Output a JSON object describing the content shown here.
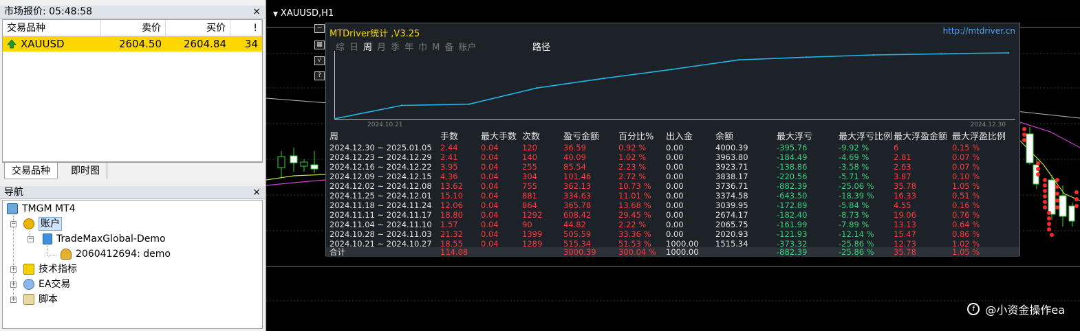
{
  "market_watch": {
    "title": "市场报价: 05:48:58",
    "close": "×",
    "headers": [
      "交易品种",
      "卖价",
      "买价",
      "!"
    ],
    "rows": [
      {
        "symbol": "XAUUSD",
        "bid": "2604.50",
        "ask": "2604.84",
        "spread": "34"
      }
    ],
    "tabs": [
      "交易品种",
      "即时图"
    ]
  },
  "navigator": {
    "title": "导航",
    "close": "×",
    "items": [
      {
        "label": "TMGM MT4"
      },
      {
        "label": "账户"
      },
      {
        "label": "TradeMaxGlobal-Demo"
      },
      {
        "label": "2060412694: demo"
      },
      {
        "label": "技术指标"
      },
      {
        "label": "EA交易"
      },
      {
        "label": "脚本"
      }
    ]
  },
  "chart": {
    "symbol": "XAUUSD,H1",
    "watermark": "@小资金操作ea"
  },
  "stats_panel": {
    "title": "MTDriver统计 ,V3.25",
    "url": "http://mtdriver.cn",
    "periods": [
      "综",
      "日",
      "周",
      "月",
      "季",
      "年",
      "巾",
      "M",
      "备",
      "账户"
    ],
    "active_period": "周",
    "route_label": "路径",
    "chart_start_label": "2024.10.21",
    "chart_end_label": "2024.12.30",
    "headers": [
      "周",
      "手数",
      "最大手数",
      "次数",
      "盈亏金额",
      "百分比%",
      "出入金",
      "余额",
      "最大浮亏",
      "最大浮亏比例",
      "最大浮盈金额",
      "最大浮盈比例"
    ],
    "rows": [
      [
        "2024.12.30 ~ 2025.01.05",
        "2.44",
        "0.04",
        "120",
        "36.59",
        "0.92 %",
        "0.00",
        "4000.39",
        "-395.76",
        "-9.92 %",
        "6",
        "0.15 %"
      ],
      [
        "2024.12.23 ~ 2024.12.29",
        "2.41",
        "0.04",
        "140",
        "40.09",
        "1.02 %",
        "0.00",
        "3963.80",
        "-184.49",
        "-4.69 %",
        "2.81",
        "0.07 %"
      ],
      [
        "2024.12.16 ~ 2024.12.22",
        "3.95",
        "0.04",
        "255",
        "85.54",
        "2.23 %",
        "0.00",
        "3923.71",
        "-138.86",
        "-3.58 %",
        "2.63",
        "0.07 %"
      ],
      [
        "2024.12.09 ~ 2024.12.15",
        "4.36",
        "0.04",
        "304",
        "101.46",
        "2.72 %",
        "0.00",
        "3838.17",
        "-220.56",
        "-5.71 %",
        "3.87",
        "0.10 %"
      ],
      [
        "2024.12.02 ~ 2024.12.08",
        "13.62",
        "0.04",
        "755",
        "362.13",
        "10.73 %",
        "0.00",
        "3736.71",
        "-882.39",
        "-25.06 %",
        "35.78",
        "1.05 %"
      ],
      [
        "2024.11.25 ~ 2024.12.01",
        "15.10",
        "0.04",
        "881",
        "334.63",
        "11.01 %",
        "0.00",
        "3374.58",
        "-643.50",
        "-18.39 %",
        "16.33",
        "0.51 %"
      ],
      [
        "2024.11.18 ~ 2024.11.24",
        "12.06",
        "0.04",
        "864",
        "365.78",
        "13.68 %",
        "0.00",
        "3039.95",
        "-172.89",
        "-5.84 %",
        "4.55",
        "0.16 %"
      ],
      [
        "2024.11.11 ~ 2024.11.17",
        "18.80",
        "0.04",
        "1292",
        "608.42",
        "29.45 %",
        "0.00",
        "2674.17",
        "-182.40",
        "-8.73 %",
        "19.06",
        "0.76 %"
      ],
      [
        "2024.11.04 ~ 2024.11.10",
        "1.57",
        "0.04",
        "90",
        "44.82",
        "2.22 %",
        "0.00",
        "2065.75",
        "-161.99",
        "-7.89 %",
        "13.13",
        "0.64 %"
      ],
      [
        "2024.10.28 ~ 2024.11.03",
        "21.32",
        "0.04",
        "1399",
        "505.59",
        "33.36 %",
        "0.00",
        "2020.93",
        "-121.93",
        "-12.14 %",
        "15.47",
        "0.86 %"
      ],
      [
        "2024.10.21 ~ 2024.10.27",
        "18.55",
        "0.04",
        "1289",
        "515.34",
        "51.53 %",
        "1000.00",
        "1515.34",
        "-373.32",
        "-25.86 %",
        "12.73",
        "1.02 %"
      ]
    ],
    "total": [
      "合计",
      "114.08",
      "",
      "",
      "3000.39",
      "300.04 %",
      "1000.00",
      "",
      "-882.39",
      "-25.86 %",
      "35.78",
      "1.05 %"
    ],
    "equity_curve": {
      "x": [
        "2024.10.21",
        "2024.10.28",
        "2024.11.04",
        "2024.11.11",
        "2024.11.18",
        "2024.11.25",
        "2024.12.02",
        "2024.12.09",
        "2024.12.16",
        "2024.12.23",
        "2024.12.30"
      ],
      "y": [
        1515.34,
        2020.93,
        2065.75,
        2674.17,
        3039.95,
        3374.58,
        3736.71,
        3838.17,
        3923.71,
        3963.8,
        4000.39
      ]
    }
  }
}
